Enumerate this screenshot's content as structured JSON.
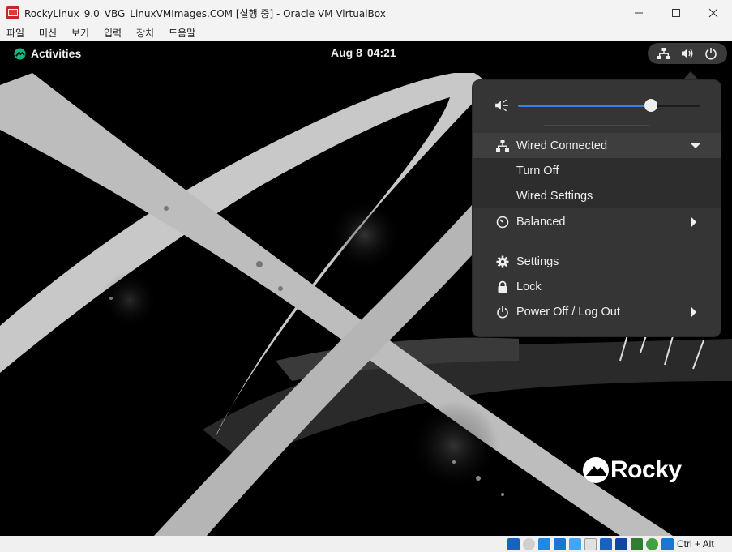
{
  "window": {
    "title": "RockyLinux_9.0_VBG_LinuxVMImages.COM [실행 중] - Oracle VM VirtualBox"
  },
  "menubar": {
    "items": [
      "파일",
      "머신",
      "보기",
      "입력",
      "장치",
      "도움말"
    ]
  },
  "topbar": {
    "activities_label": "Activities",
    "clock_date": "Aug 8",
    "clock_time": "04:21"
  },
  "desktop": {
    "logo_text": "Rocky"
  },
  "system_menu": {
    "volume_level": 0.73,
    "network": {
      "label": "Wired Connected",
      "submenu": [
        "Turn Off",
        "Wired Settings"
      ]
    },
    "power_mode_label": "Balanced",
    "settings_label": "Settings",
    "lock_label": "Lock",
    "power_off_label": "Power Off / Log Out"
  },
  "statusbar": {
    "host_key": "Ctrl + Alt"
  },
  "colors": {
    "accent": "#3584e4",
    "popover_bg": "#353535",
    "text": "#eeeeec",
    "rocky_green": "#10b981"
  }
}
